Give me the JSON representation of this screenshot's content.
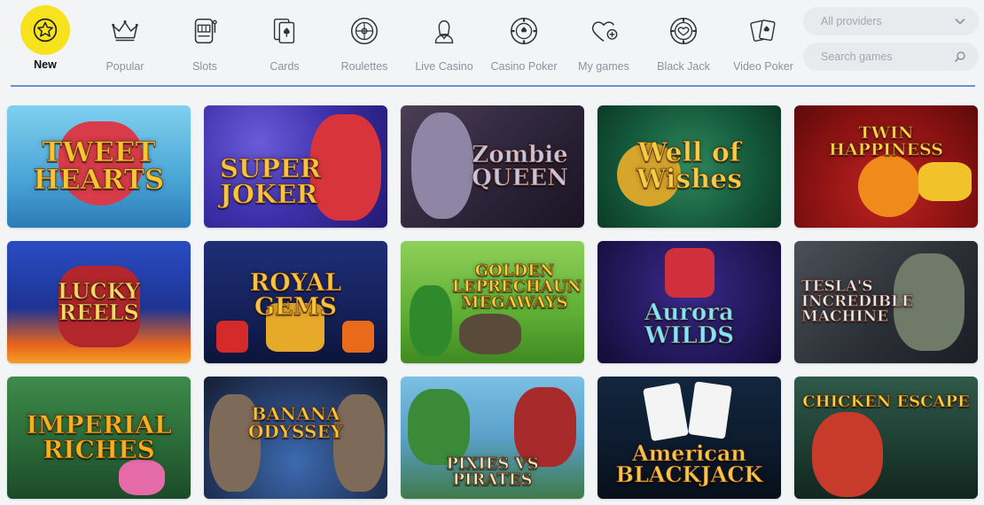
{
  "categories": [
    {
      "label": "New",
      "icon": "star-icon",
      "active": true
    },
    {
      "label": "Popular",
      "icon": "crown-icon"
    },
    {
      "label": "Slots",
      "icon": "slot-machine-icon"
    },
    {
      "label": "Cards",
      "icon": "cards-icon"
    },
    {
      "label": "Roulettes",
      "icon": "roulette-icon"
    },
    {
      "label": "Live Casino",
      "icon": "dealer-icon"
    },
    {
      "label": "Casino Poker",
      "icon": "poker-chip-icon"
    },
    {
      "label": "My games",
      "icon": "heart-plus-icon"
    },
    {
      "label": "Black Jack",
      "icon": "blackjack-chip-icon"
    },
    {
      "label": "Video Poker",
      "icon": "video-poker-cards-icon"
    }
  ],
  "filters": {
    "providers_value": "All providers",
    "search_placeholder": "Search games"
  },
  "games": [
    {
      "title": "TWEET HEARTS"
    },
    {
      "title": "SUPER JOKER"
    },
    {
      "title": "Zombie QUEEN"
    },
    {
      "title": "Well of Wishes"
    },
    {
      "title": "TWIN HAPPINESS"
    },
    {
      "title": "LUCKY REELS"
    },
    {
      "title": "ROYAL GEMS"
    },
    {
      "title": "GOLDEN LEPRECHAUN MEGAWAYS"
    },
    {
      "title": "Aurora WILDS"
    },
    {
      "title": "TESLA'S INCREDIBLE MACHINE"
    },
    {
      "title": "IMPERIAL RICHES"
    },
    {
      "title": "BANANA ODYSSEY"
    },
    {
      "title": "PIXIES VS PIRATES"
    },
    {
      "title": "American BLACKJACK"
    },
    {
      "title": "CHICKEN ESCAPE"
    }
  ]
}
